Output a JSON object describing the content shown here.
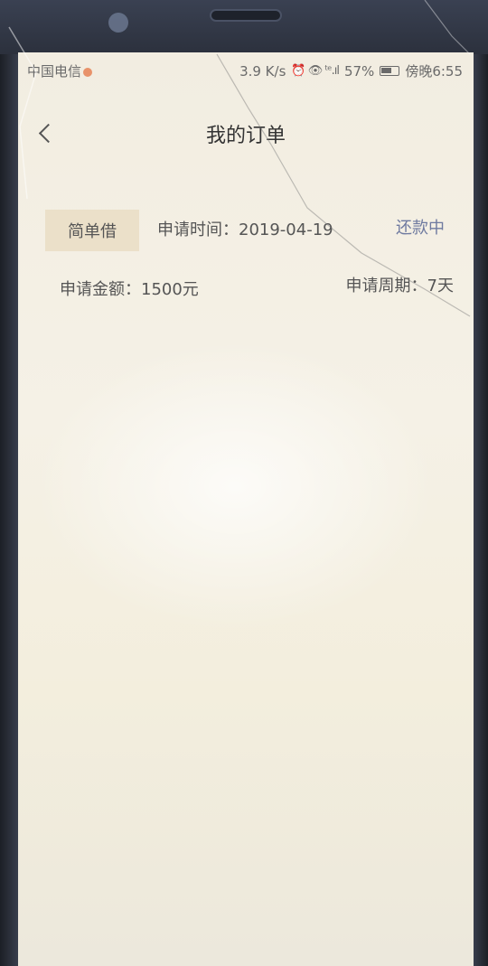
{
  "status_bar": {
    "carrier": "中国电信",
    "network_speed": "3.9 K/s",
    "indicators": "⏰ 👁 ᵗᵉ.ıl",
    "battery": "57%",
    "time": "傍晚6:55"
  },
  "header": {
    "title": "我的订单"
  },
  "order": {
    "product": "简单借",
    "apply_time": "申请时间：2019-04-19",
    "status": "还款中",
    "amount": "申请金额：1500元",
    "period": "申请周期：7天"
  },
  "colors": {
    "status": "#6f7aa0",
    "tag_bg": "#ebe0c9"
  }
}
